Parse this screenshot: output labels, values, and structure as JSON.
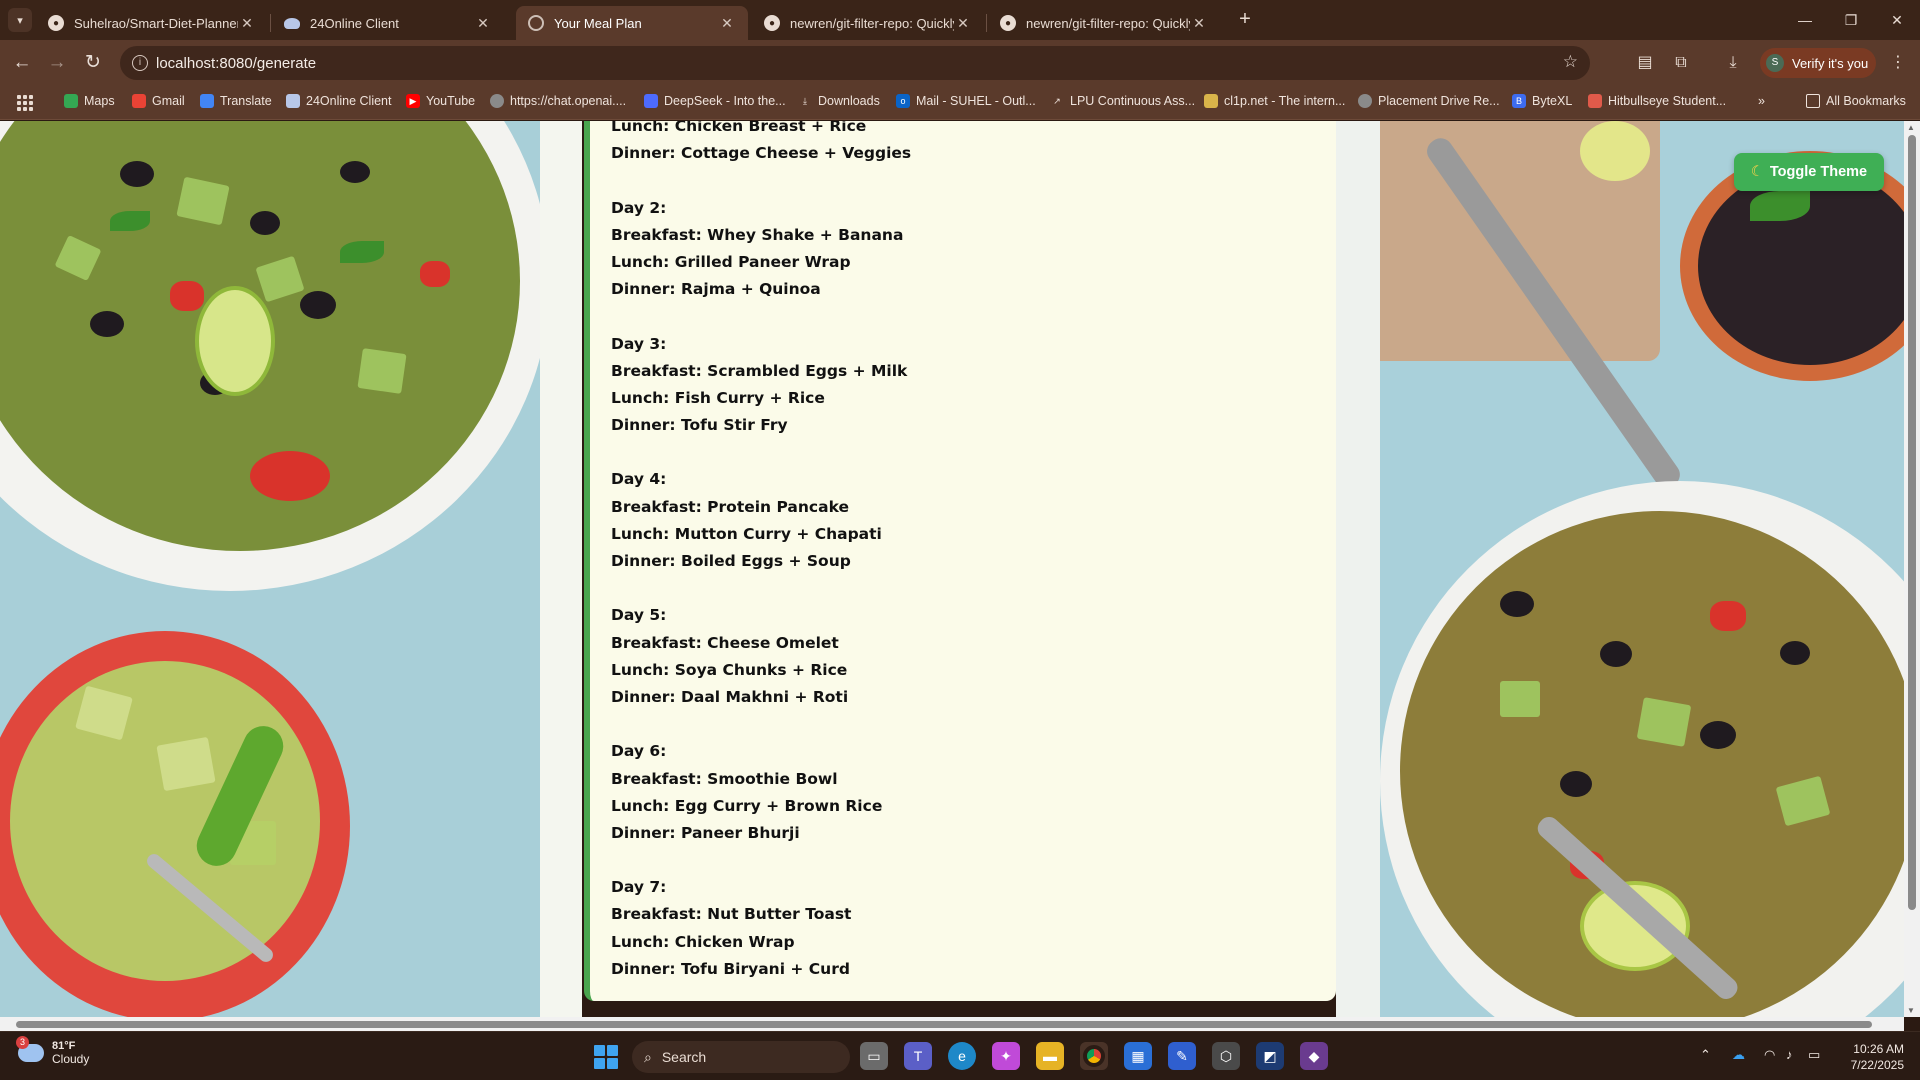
{
  "tabs": [
    {
      "title": "Suhelrao/Smart-Diet-Planner",
      "icon": "github-icon",
      "active": false
    },
    {
      "title": "24Online Client",
      "icon": "cloud-icon",
      "active": false
    },
    {
      "title": "Your Meal Plan",
      "icon": "globe-icon",
      "active": true
    },
    {
      "title": "newren/git-filter-repo: Quickly",
      "icon": "github-icon",
      "active": false
    },
    {
      "title": "newren/git-filter-repo: Quickly",
      "icon": "github-icon",
      "active": false
    }
  ],
  "address_bar": {
    "url": "localhost:8080/generate"
  },
  "profile": {
    "initial": "S",
    "label": "Verify it's you"
  },
  "bookmarks": [
    {
      "label": "Maps",
      "color": "#34a853"
    },
    {
      "label": "Gmail",
      "color": "#ea4335"
    },
    {
      "label": "Translate",
      "color": "#4285f4"
    },
    {
      "label": "24Online Client",
      "color": "#b8c7e8"
    },
    {
      "label": "YouTube",
      "color": "#ff0000"
    },
    {
      "label": "https://chat.openai....",
      "color": "#cfcfcf"
    },
    {
      "label": "DeepSeek - Into the...",
      "color": "#4d6bfe"
    },
    {
      "label": "Downloads",
      "color": "#e0e0e0"
    },
    {
      "label": "Mail - SUHEL - Outl...",
      "color": "#0a64c8"
    },
    {
      "label": "LPU Continuous Ass...",
      "color": "#e0e0e0"
    },
    {
      "label": "cl1p.net - The intern...",
      "color": "#d9b44a"
    },
    {
      "label": "Placement Drive Re...",
      "color": "#cfcfcf"
    },
    {
      "label": "ByteXL",
      "color": "#3d6cf0"
    },
    {
      "label": "Hitbullseye Student...",
      "color": "#e05a4a"
    }
  ],
  "all_bookmarks_label": "All Bookmarks",
  "theme_button": {
    "label": "Toggle Theme",
    "icon": "moon-icon"
  },
  "meal_plan": {
    "partial_top": [
      "Lunch: Chicken Breast + Rice",
      "Dinner: Cottage Cheese + Veggies"
    ],
    "days": [
      {
        "day": "Day 2:",
        "breakfast": "Breakfast: Whey Shake + Banana",
        "lunch": "Lunch: Grilled Paneer Wrap",
        "dinner": "Dinner: Rajma + Quinoa"
      },
      {
        "day": "Day 3:",
        "breakfast": "Breakfast: Scrambled Eggs + Milk",
        "lunch": "Lunch: Fish Curry + Rice",
        "dinner": "Dinner: Tofu Stir Fry"
      },
      {
        "day": "Day 4:",
        "breakfast": "Breakfast: Protein Pancake",
        "lunch": "Lunch: Mutton Curry + Chapati",
        "dinner": "Dinner: Boiled Eggs + Soup"
      },
      {
        "day": "Day 5:",
        "breakfast": "Breakfast: Cheese Omelet",
        "lunch": "Lunch: Soya Chunks + Rice",
        "dinner": "Dinner: Daal Makhni + Roti"
      },
      {
        "day": "Day 6:",
        "breakfast": "Breakfast: Smoothie Bowl",
        "lunch": "Lunch: Egg Curry + Brown Rice",
        "dinner": "Dinner: Paneer Bhurji"
      },
      {
        "day": "Day 7:",
        "breakfast": "Breakfast: Nut Butter Toast",
        "lunch": "Lunch: Chicken Wrap",
        "dinner": "Dinner: Tofu Biryani + Curd"
      }
    ]
  },
  "taskbar": {
    "weather_temp": "81°F",
    "weather_desc": "Cloudy",
    "weather_badge": "3",
    "search_placeholder": "Search",
    "time": "10:26 AM",
    "date": "7/22/2025"
  },
  "colors": {
    "accent_green": "#4aa54e",
    "card_bg": "#fbfbe9",
    "toggle_bg": "#3faf55",
    "chrome_bg": "#5a3a2b"
  }
}
